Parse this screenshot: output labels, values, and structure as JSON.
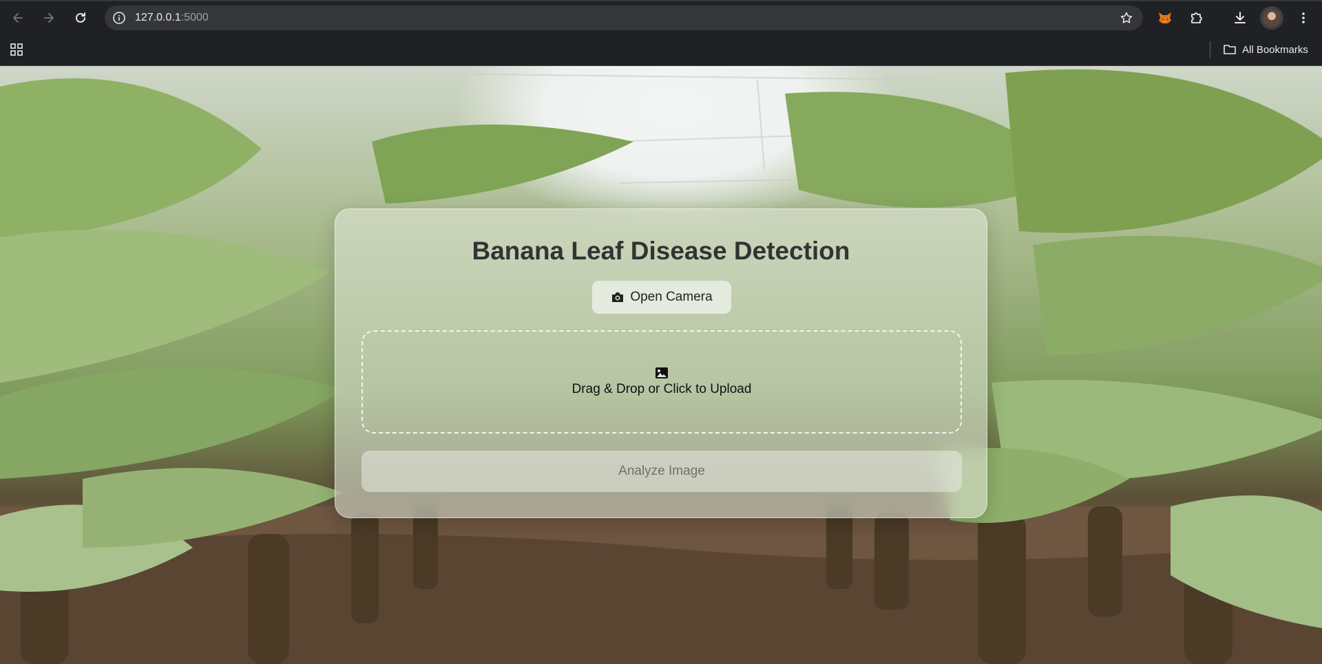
{
  "browser": {
    "url_host": "127.0.0.1",
    "url_port": ":5000",
    "bookmarks_label": "All Bookmarks"
  },
  "icons": {
    "back": "arrow-left-icon",
    "forward": "arrow-right-icon",
    "reload": "reload-icon",
    "site_info": "info-icon",
    "bookmark": "star-icon",
    "fox_extension": "fox-icon",
    "extensions": "puzzle-icon",
    "downloads": "download-icon",
    "menu": "kebab-menu-icon",
    "apps": "apps-grid-icon",
    "folder": "folder-icon",
    "camera": "camera-icon",
    "upload": "image-icon"
  },
  "page": {
    "title": "Banana Leaf Disease Detection",
    "open_camera_label": "Open Camera",
    "upload_prompt": "Drag & Drop or Click to Upload",
    "analyze_label": "Analyze Image"
  },
  "colors": {
    "title": "#333333",
    "analyze_disabled_text": "#707070",
    "browser_chrome": "#202124"
  }
}
